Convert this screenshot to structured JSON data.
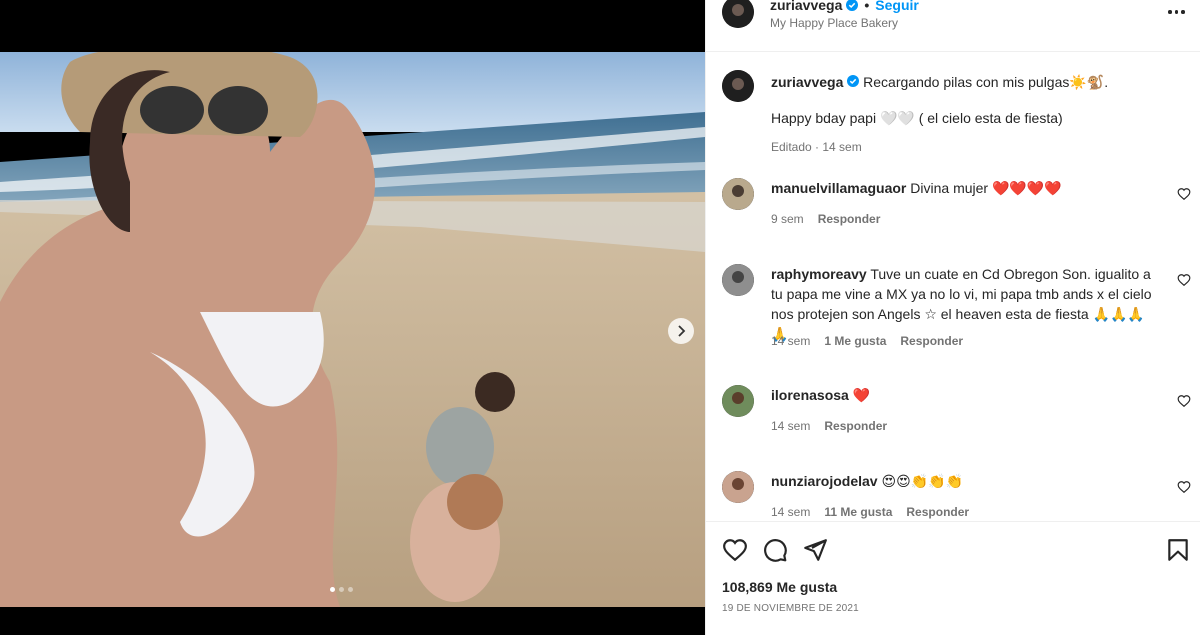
{
  "post": {
    "username": "zuriavvega",
    "follow_label": "Seguir",
    "location": "My Happy Place Bakery",
    "caption_text": "Recargando pilas con mis pulgas☀️🐒.",
    "caption_line2": "Happy bday papi 🤍🤍 ( el cielo esta de fiesta)",
    "caption_meta": "Editado · 14 sem",
    "likes": "108,869 Me gusta",
    "date": "19 DE NOVIEMBRE DE 2021",
    "carousel": {
      "slide_count": 3,
      "current": 1
    }
  },
  "comments": [
    {
      "user": "manuelvillamaguaor",
      "text": "Divina mujer ❤️❤️❤️❤️",
      "time": "9 sem",
      "likes": "",
      "reply": "Responder"
    },
    {
      "user": "raphymoreavy",
      "text": "Tuve un cuate en Cd Obregon Son. igualito a tu papa me vine a MX ya no lo vi, mi papa tmb ands x el cielo nos protejen son Angels ☆ el heaven esta de fiesta 🙏🙏🙏🙏",
      "time": "14 sem",
      "likes": "1 Me gusta",
      "reply": "Responder"
    },
    {
      "user": "ilorenasosa",
      "text": "❤️",
      "time": "14 sem",
      "likes": "",
      "reply": "Responder"
    },
    {
      "user": "nunziarojodelav",
      "text": "😍😍👏👏👏",
      "time": "14 sem",
      "likes": "11 Me gusta",
      "reply": "Responder"
    }
  ],
  "icons": [
    "verified-icon",
    "more-options-icon",
    "chevron-right-icon",
    "heart-icon",
    "comment-icon",
    "share-icon",
    "bookmark-icon"
  ],
  "colors": {
    "link": "#0095f6",
    "text": "#262626",
    "muted": "#737373",
    "heart": "#c2182b"
  }
}
